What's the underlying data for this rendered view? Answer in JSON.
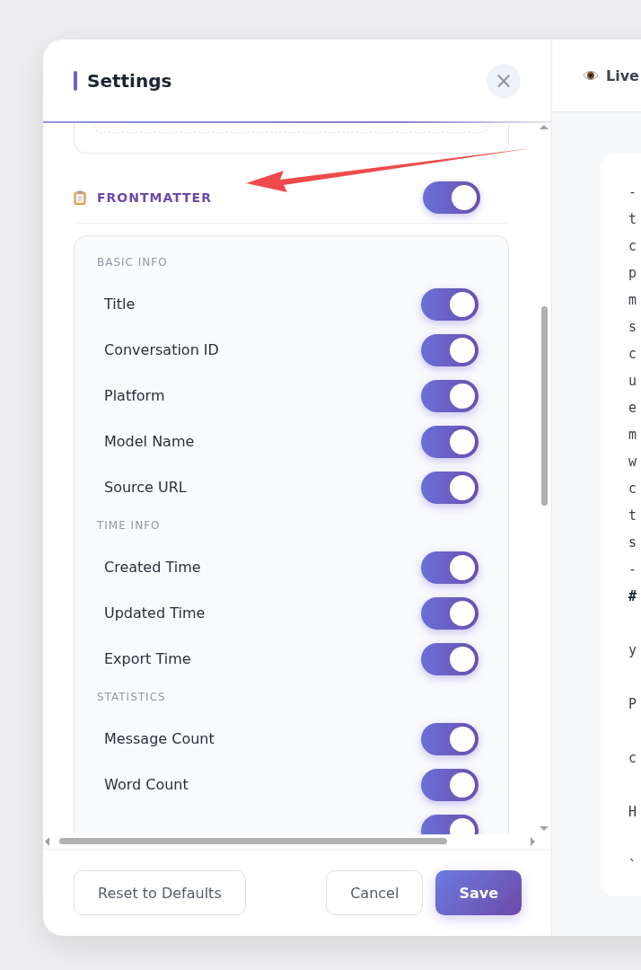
{
  "settings": {
    "title": "Settings",
    "close": "×"
  },
  "frontmatter": {
    "title": "FRONTMATTER",
    "on": true
  },
  "groups": [
    {
      "label": "BASIC INFO",
      "items": [
        {
          "label": "Title",
          "on": true
        },
        {
          "label": "Conversation ID",
          "on": true
        },
        {
          "label": "Platform",
          "on": true
        },
        {
          "label": "Model Name",
          "on": true
        },
        {
          "label": "Source URL",
          "on": true
        }
      ]
    },
    {
      "label": "TIME INFO",
      "items": [
        {
          "label": "Created Time",
          "on": true
        },
        {
          "label": "Updated Time",
          "on": true
        },
        {
          "label": "Export Time",
          "on": true
        }
      ]
    },
    {
      "label": "STATISTICS",
      "items": [
        {
          "label": "Message Count",
          "on": true
        },
        {
          "label": "Word Count",
          "on": true
        },
        {
          "on": true
        }
      ]
    }
  ],
  "footer": {
    "reset": "Reset to Defaults",
    "cancel": "Cancel",
    "save": "Save"
  },
  "preview": {
    "title": "Live",
    "lines": [
      {
        "text": "-",
        "kind": "plain"
      },
      {
        "text": "t",
        "kind": "plain"
      },
      {
        "text": "c",
        "kind": "plain"
      },
      {
        "text": "p",
        "kind": "plain"
      },
      {
        "text": "m",
        "kind": "plain"
      },
      {
        "text": "s",
        "kind": "plain"
      },
      {
        "text": "c",
        "kind": "plain"
      },
      {
        "text": "u",
        "kind": "plain"
      },
      {
        "text": "e",
        "kind": "plain"
      },
      {
        "text": "m",
        "kind": "plain"
      },
      {
        "text": "w",
        "kind": "plain"
      },
      {
        "text": "c",
        "kind": "plain"
      },
      {
        "text": "t",
        "kind": "plain"
      },
      {
        "text": "s",
        "kind": "plain"
      },
      {
        "text": "-",
        "kind": "plain"
      },
      {
        "text": "#",
        "kind": "heading"
      },
      {
        "kind": "blank"
      },
      {
        "text": "y",
        "kind": "plain"
      },
      {
        "kind": "blank"
      },
      {
        "text": "P",
        "kind": "plain"
      },
      {
        "kind": "blank"
      },
      {
        "text": "c",
        "kind": "plain"
      },
      {
        "kind": "blank"
      },
      {
        "text": "H",
        "kind": "plain"
      },
      {
        "kind": "blank"
      },
      {
        "text": "`",
        "kind": "plain"
      }
    ]
  }
}
